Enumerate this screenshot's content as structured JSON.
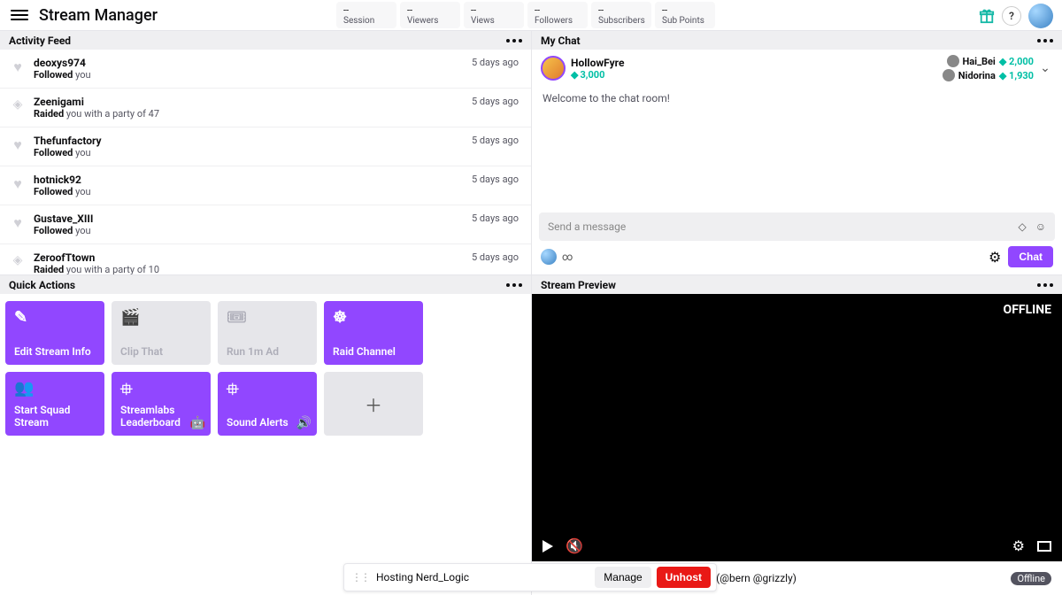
{
  "header": {
    "title": "Stream Manager",
    "stats": [
      {
        "value": "--",
        "label": "Session"
      },
      {
        "value": "--",
        "label": "Viewers"
      },
      {
        "value": "--",
        "label": "Views"
      },
      {
        "value": "--",
        "label": "Followers"
      },
      {
        "value": "--",
        "label": "Subscribers"
      },
      {
        "value": "--",
        "label": "Sub Points"
      }
    ]
  },
  "activity_feed": {
    "title": "Activity Feed",
    "items": [
      {
        "type": "follow",
        "user": "deoxys974",
        "desc_prefix": "Followed",
        "desc_rest": " you",
        "time": "5 days ago"
      },
      {
        "type": "raid",
        "user": "Zeenigami",
        "desc_prefix": "Raided",
        "desc_rest": " you with a party of 47",
        "time": "5 days ago"
      },
      {
        "type": "follow",
        "user": "Thefunfactory",
        "desc_prefix": "Followed",
        "desc_rest": " you",
        "time": "5 days ago"
      },
      {
        "type": "follow",
        "user": "hotnick92",
        "desc_prefix": "Followed",
        "desc_rest": " you",
        "time": "5 days ago"
      },
      {
        "type": "follow",
        "user": "Gustave_XIII",
        "desc_prefix": "Followed",
        "desc_rest": " you",
        "time": "5 days ago"
      },
      {
        "type": "raid",
        "user": "ZeroofTtown",
        "desc_prefix": "Raided",
        "desc_rest": " you with a party of 10",
        "time": "5 days ago"
      }
    ]
  },
  "quick_actions": {
    "title": "Quick Actions",
    "cards": [
      {
        "label": "Edit Stream Info",
        "style": "purple",
        "icon": "pencil"
      },
      {
        "label": "Clip That",
        "style": "gray",
        "icon": "clapper"
      },
      {
        "label": "Run 1m Ad",
        "style": "gray",
        "icon": "ticket"
      },
      {
        "label": "Raid Channel",
        "style": "purple",
        "icon": "steering"
      },
      {
        "label": "Start Squad Stream",
        "style": "purple",
        "icon": "group"
      },
      {
        "label": "Streamlabs Leaderboard",
        "style": "purple",
        "icon": "ext",
        "corner": "🤖"
      },
      {
        "label": "Sound Alerts",
        "style": "purple",
        "icon": "ext",
        "corner": "🔊"
      }
    ]
  },
  "chat": {
    "title": "My Chat",
    "user": {
      "name": "HollowFyre",
      "points": "3,000"
    },
    "leaders": [
      {
        "name": "Hai_Bei",
        "points": "2,000"
      },
      {
        "name": "Nidorina",
        "points": "1,930"
      }
    ],
    "welcome": "Welcome to the chat room!",
    "placeholder": "Send a message",
    "infinity": "∞",
    "chat_btn": "Chat"
  },
  "preview": {
    "title": "Stream Preview",
    "offline": "OFFLINE",
    "meta_text": "pex. Squad Stream with Twitch Staff (@bern @grizzly)",
    "badge": "Offline"
  },
  "host_bar": {
    "text": "Hosting Nerd_Logic",
    "manage": "Manage",
    "unhost": "Unhost"
  }
}
